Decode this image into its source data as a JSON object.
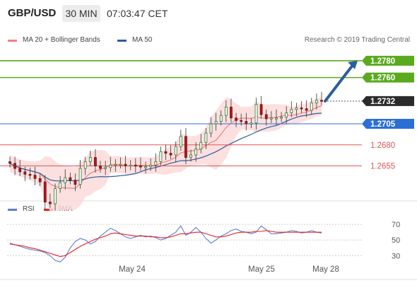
{
  "header": {
    "symbol": "GBP/USD",
    "timeframe": "30 MIN",
    "time": "07:03:47 CET"
  },
  "legend": {
    "bollinger_label": "MA 20 + Bollinger Bands",
    "ma50_label": "MA 50",
    "credit": "Research © 2019 Trading Central",
    "rsi_label": "RSI",
    "rsi_ma_label": "9MA"
  },
  "colors": {
    "bollinger": "#f08080",
    "ma50": "#2e5d9a",
    "target": "#5aaa1e",
    "pivot": "#2b6fd6",
    "support": "#e05555",
    "arrow": "#2b5d9c",
    "rsi": "#5b7fd6",
    "rsi_ma": "#e8201e"
  },
  "chart_data": [
    {
      "type": "candlestick",
      "title": "GBP/USD 30 MIN",
      "price_levels": [
        {
          "label": "1.2780",
          "kind": "target"
        },
        {
          "label": "1.2760",
          "kind": "target"
        },
        {
          "label": "1.2732",
          "kind": "last"
        },
        {
          "label": "1.2705",
          "kind": "pivot"
        },
        {
          "label": "1.2680",
          "kind": "support"
        },
        {
          "label": "1.2655",
          "kind": "support"
        }
      ],
      "x_ticks": [
        "May 24",
        "May 25",
        "May 28"
      ],
      "y_range": [
        1.261,
        1.2795
      ],
      "indicators": [
        "MA 20 + Bollinger Bands",
        "MA 50"
      ],
      "trend_arrow": {
        "from": 1.2732,
        "to": 1.278,
        "direction": "up"
      },
      "close_path": [
        1.2658,
        1.2652,
        1.2648,
        1.2645,
        1.2644,
        1.264,
        1.2636,
        1.2612,
        1.261,
        1.2628,
        1.2635,
        1.2641,
        1.2638,
        1.2633,
        1.2652,
        1.266,
        1.2665,
        1.2655,
        1.2652,
        1.2653,
        1.2656,
        1.2657,
        1.2657,
        1.2655,
        1.2656,
        1.2655,
        1.2654,
        1.2654,
        1.2656,
        1.266,
        1.2672,
        1.267,
        1.2668,
        1.2678,
        1.269,
        1.2665,
        1.2668,
        1.2675,
        1.2683,
        1.2694,
        1.2705,
        1.2708,
        1.2715,
        1.2725,
        1.2712,
        1.2709,
        1.2708,
        1.2705,
        1.2706,
        1.2728,
        1.2716,
        1.2711,
        1.2712,
        1.2712,
        1.2713,
        1.2718,
        1.2722,
        1.2724,
        1.2723,
        1.2721,
        1.273,
        1.2733,
        1.2732
      ]
    },
    {
      "type": "line",
      "title": "RSI",
      "y_ticks": [
        30,
        50,
        70
      ],
      "y_range": [
        15,
        80
      ],
      "series": [
        {
          "name": "RSI",
          "values": [
            46,
            44,
            42,
            40,
            38,
            37,
            36,
            34,
            30,
            24,
            22,
            28,
            40,
            48,
            52,
            50,
            45,
            48,
            55,
            60,
            65,
            62,
            58,
            54,
            52,
            54,
            56,
            54,
            55,
            53,
            50,
            52,
            56,
            60,
            68,
            56,
            60,
            66,
            60,
            52,
            46,
            50,
            55,
            58,
            62,
            64,
            61,
            60,
            58,
            60,
            68,
            63,
            58,
            58,
            59,
            60,
            62,
            61,
            59,
            60,
            62,
            60,
            59
          ]
        },
        {
          "name": "9MA",
          "values": [
            45,
            44,
            43,
            42,
            40,
            39,
            37,
            35,
            33,
            31,
            29,
            30,
            34,
            38,
            42,
            45,
            48,
            51,
            53,
            55,
            58,
            59,
            58,
            57,
            56,
            55,
            55,
            55,
            54,
            54,
            53,
            53,
            54,
            56,
            58,
            58,
            59,
            60,
            60,
            58,
            56,
            54,
            54,
            55,
            57,
            59,
            60,
            60,
            60,
            61,
            61,
            62,
            61,
            60,
            60,
            60,
            60,
            60,
            60,
            60,
            60,
            60,
            60
          ]
        }
      ],
      "x_ticks": [
        "May 24",
        "May 25",
        "May 28"
      ]
    }
  ]
}
